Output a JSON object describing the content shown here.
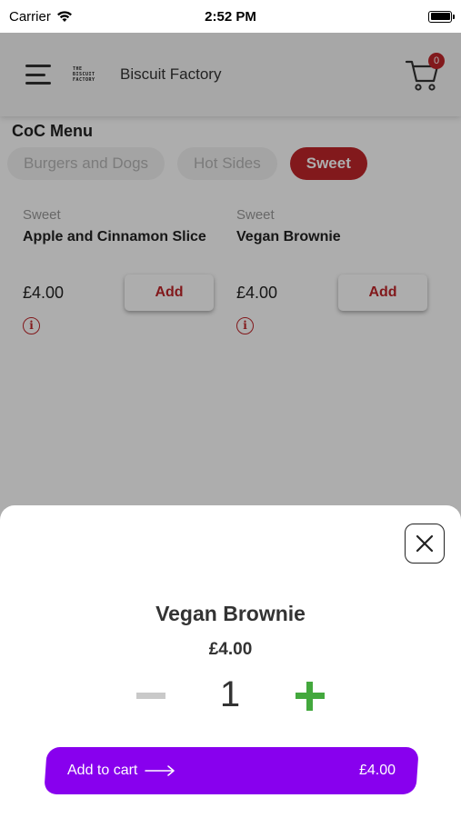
{
  "status_bar": {
    "carrier": "Carrier",
    "time": "2:52 PM"
  },
  "header": {
    "logo_lines": [
      "THE",
      "BISCUIT",
      "FACTORY"
    ],
    "brand_name": "Biscuit Factory",
    "cart_count": "0"
  },
  "menu": {
    "title": "CoC Menu",
    "tabs": [
      {
        "label": "Burgers and Dogs",
        "active": false
      },
      {
        "label": "Hot Sides",
        "active": false
      },
      {
        "label": "Sweet",
        "active": true
      }
    ],
    "products": [
      {
        "category": "Sweet",
        "name": "Apple and Cinnamon Slice",
        "price": "£4.00",
        "add_label": "Add",
        "info_glyph": "i"
      },
      {
        "category": "Sweet",
        "name": "Vegan Brownie",
        "price": "£4.00",
        "add_label": "Add",
        "info_glyph": "i"
      }
    ]
  },
  "sheet": {
    "title": "Vegan Brownie",
    "price": "£4.00",
    "quantity": "1",
    "add_to_cart_label": "Add to cart",
    "total": "£4.00"
  },
  "colors": {
    "accent_red": "#c0262a",
    "purple": "#8800ee",
    "plus_green": "#43a83d"
  }
}
